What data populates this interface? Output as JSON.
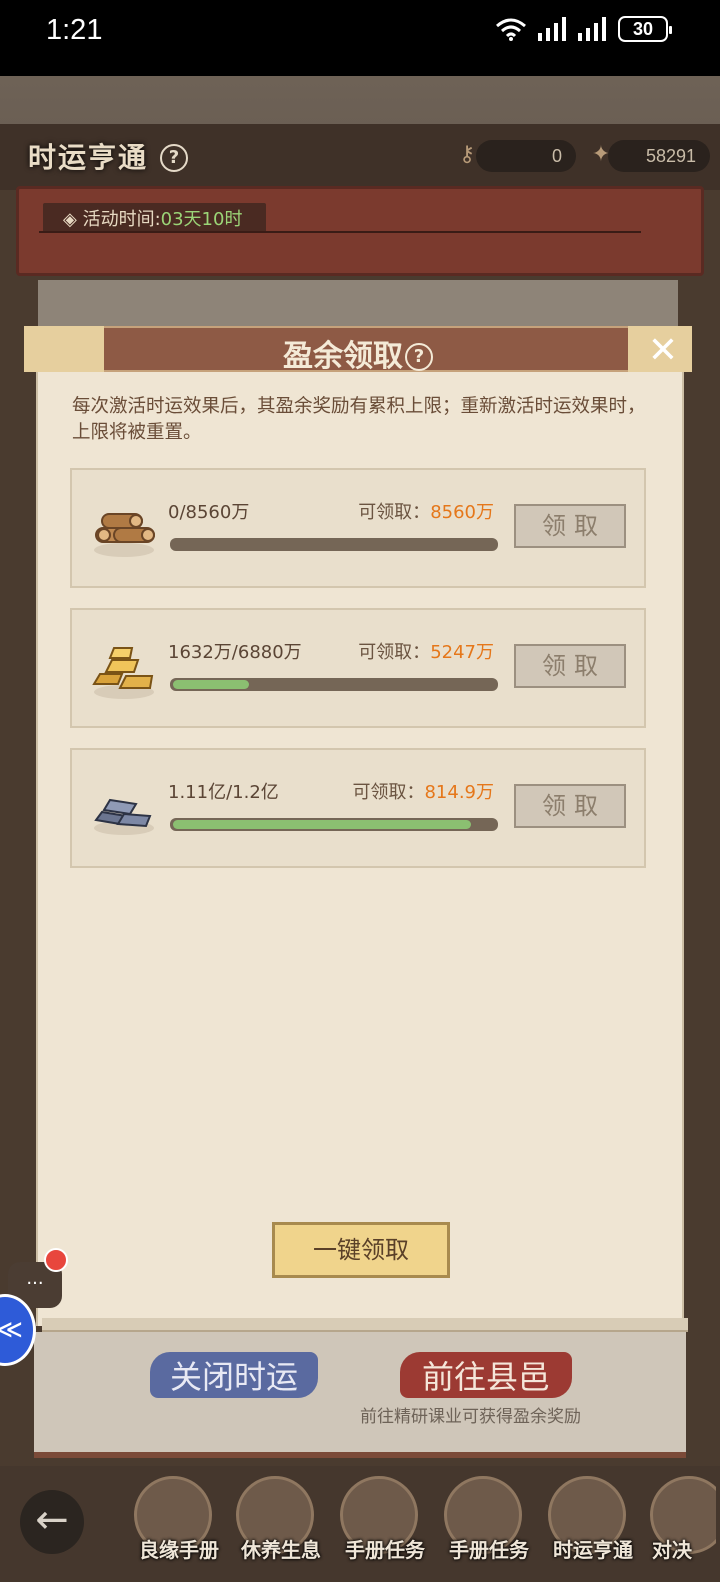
{
  "status_bar": {
    "time": "1:21",
    "battery": "30"
  },
  "game": {
    "title": "时运亨通",
    "help": "?",
    "resources": [
      {
        "icon": "key-icon",
        "value": "0"
      },
      {
        "icon": "coin-pouch-icon",
        "value": "58291"
      }
    ],
    "activity_label": "活动时间:",
    "activity_time": "03天10时"
  },
  "dialog": {
    "title": "盈余领取",
    "help": "?",
    "close": "✕",
    "description": "每次激活时运效果后，其盈余奖励有累积上限；重新激活时运效果时，上限将被重置。",
    "rows": [
      {
        "icon": "wood-logs-icon",
        "count": "0/8560万",
        "avail_label": "可领取：",
        "avail_value": "8560万",
        "progress": 0.0,
        "button": "领取"
      },
      {
        "icon": "gold-bars-icon",
        "count": "1632万/6880万",
        "avail_label": "可领取：",
        "avail_value": "5247万",
        "progress": 0.237,
        "button": "领取"
      },
      {
        "icon": "iron-ingots-icon",
        "count": "1.11亿/1.2亿",
        "avail_label": "可领取：",
        "avail_value": "814.9万",
        "progress": 0.925,
        "button": "领取"
      }
    ],
    "claim_all": "一键领取"
  },
  "actions": {
    "close_fortune": "关闭时运",
    "go_county": "前往县邑",
    "hint": "前往精研课业可获得盈余奖励"
  },
  "nav": {
    "back": "←",
    "items": [
      "良缘手册",
      "休养生息",
      "手册任务",
      "手册任务",
      "时运亨通",
      "对决"
    ]
  },
  "chat": {
    "dots": "···"
  }
}
